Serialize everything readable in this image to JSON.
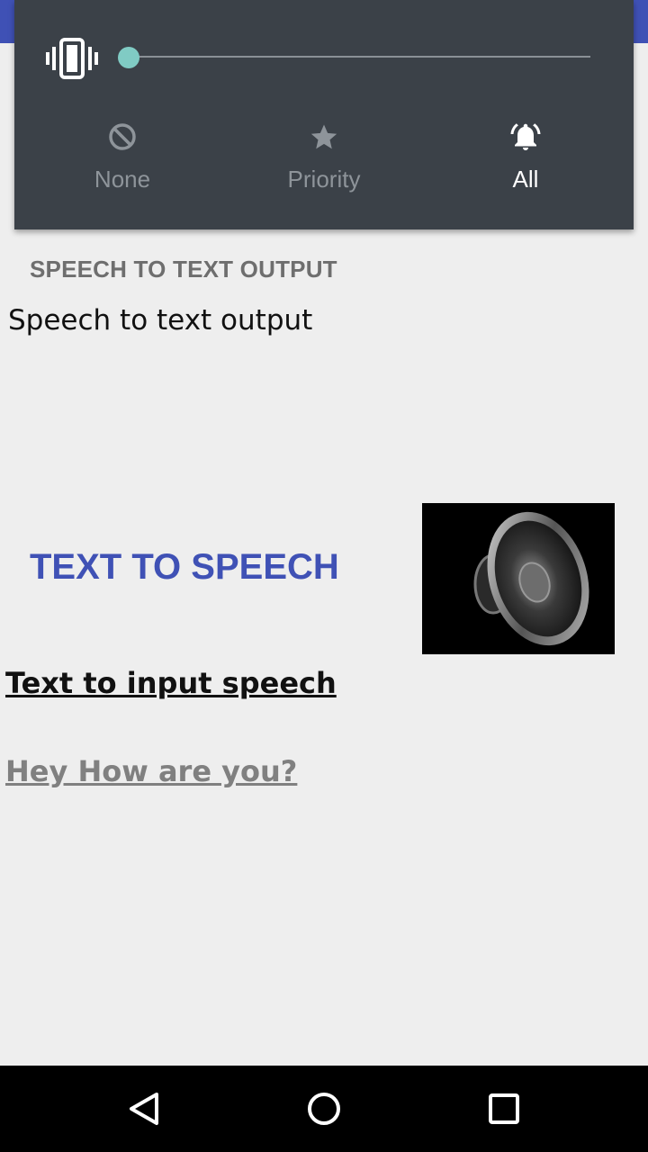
{
  "colors": {
    "accent": "#3f51b5",
    "panel": "#3b4148",
    "slider_thumb": "#80cbc4",
    "background": "#eeeeee"
  },
  "volume_panel": {
    "vibrate_icon": "vibrate-icon",
    "slider_level": 0.0,
    "modes": [
      {
        "label": "None",
        "icon": "block-icon",
        "selected": false
      },
      {
        "label": "Priority",
        "icon": "star-icon",
        "selected": false
      },
      {
        "label": "All",
        "icon": "bell-ringing-icon",
        "selected": true
      }
    ]
  },
  "speech_to_text": {
    "heading": "SPEECH TO TEXT OUTPUT",
    "output": "Speech to text output"
  },
  "text_to_speech": {
    "heading": "TEXT TO SPEECH",
    "speaker_image": "speaker-icon",
    "input_label": "Text to input speech",
    "input_value": "Hey How are you?"
  },
  "nav": {
    "back": "back-icon",
    "home": "home-icon",
    "recents": "recents-icon"
  }
}
